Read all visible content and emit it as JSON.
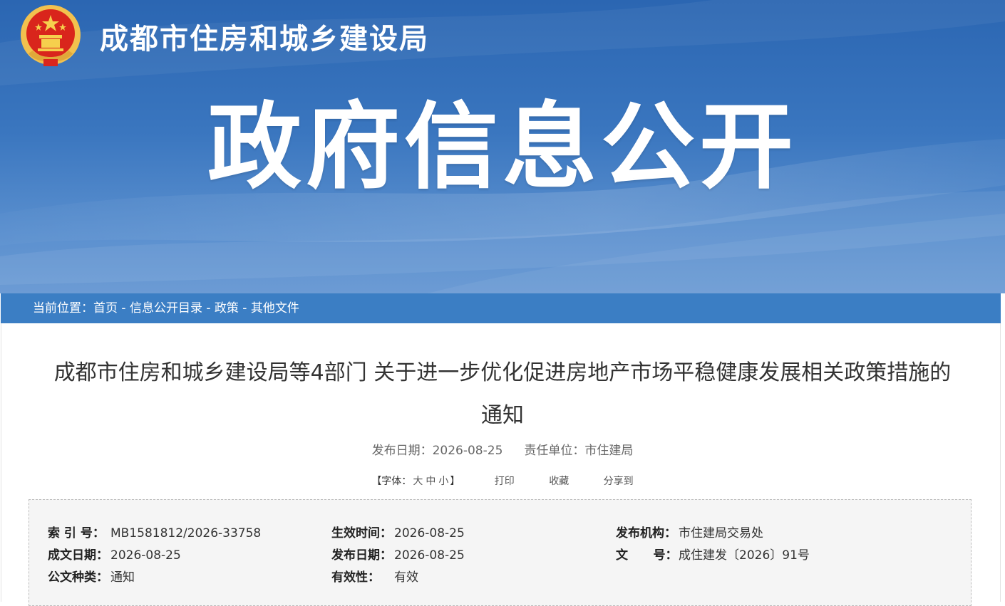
{
  "header": {
    "site_name": "成都市住房和城乡建设局",
    "banner_title": "政府信息公开",
    "emblem_icon": "national-emblem-icon"
  },
  "breadcrumb": {
    "prefix": "当前位置：",
    "items": [
      "首页",
      "信息公开目录",
      "政策",
      "其他文件"
    ],
    "separator": " - "
  },
  "article": {
    "title_line1": "成都市住房和城乡建设局等4部门 关于进一步优化促进房地产市场平稳健康发展相关政策措施的",
    "title_line2": "通知",
    "publish_date_label": "发布日期：",
    "publish_date": "2026-08-25",
    "department_label": "责任单位：",
    "department": "市住建局"
  },
  "tools": {
    "font_open": "【字体：",
    "font_large": "大",
    "font_medium": "中",
    "font_small": "小",
    "font_close": "】",
    "print": "打印",
    "favorite": "收藏",
    "share": "分享到"
  },
  "info": {
    "index_no_label": "索 引 号：",
    "index_no": "MB1581812/2026-33758",
    "created_date_label": "成文日期：",
    "created_date": "2026-08-25",
    "doc_type_label": "公文种类：",
    "doc_type": "通知",
    "effective_time_label": "生效时间：",
    "effective_time": "2026-08-25",
    "publish_date_label": "发布日期：",
    "publish_date": "2026-08-25",
    "validity_label": "有效性：",
    "validity": "有效",
    "issuer_label": "发布机构：",
    "issuer": "市住建局交易处",
    "doc_no_label": "文      号：",
    "doc_no": "成住建发〔2026〕91号"
  },
  "colors": {
    "banner_top": "#2b66b2",
    "banner_bottom": "#6c9bd4",
    "breadcrumb_bar": "#3b7ec4",
    "emblem_red": "#d9251c",
    "emblem_gold": "#f2c14e",
    "info_bg": "#f5f5f5"
  }
}
